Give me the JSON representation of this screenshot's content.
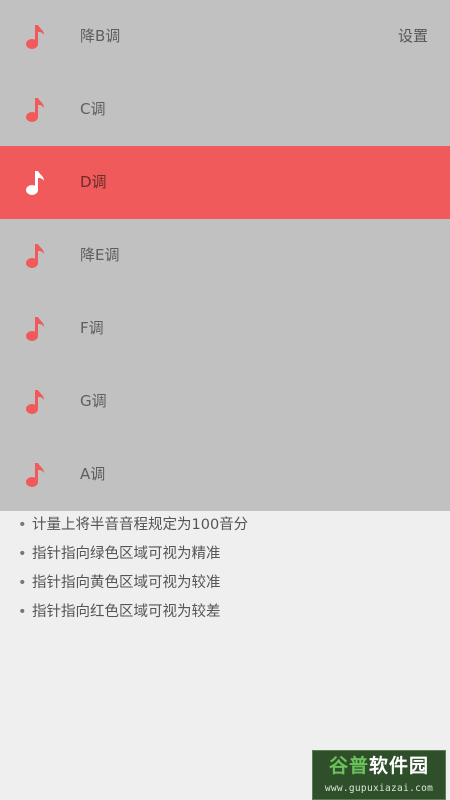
{
  "colors": {
    "list_background": "#c1c1c1",
    "selected_background": "#f05a5a",
    "note_icon": "#f05a5a",
    "note_icon_selected": "#ffffff",
    "page_background": "#efefef"
  },
  "header": {
    "settings_label": "设置"
  },
  "keys": [
    {
      "label": "降B调",
      "icon": "music-note-icon",
      "selected": false
    },
    {
      "label": "C调",
      "icon": "music-note-icon",
      "selected": false
    },
    {
      "label": "D调",
      "icon": "music-note-icon",
      "selected": true
    },
    {
      "label": "降E调",
      "icon": "music-note-icon",
      "selected": false
    },
    {
      "label": "F调",
      "icon": "music-note-icon",
      "selected": false
    },
    {
      "label": "G调",
      "icon": "music-note-icon",
      "selected": false
    },
    {
      "label": "A调",
      "icon": "music-note-icon",
      "selected": false
    }
  ],
  "tips": {
    "bullet": "•",
    "items": [
      "计量上将半音音程规定为100音分",
      "指针指向绿色区域可视为精准",
      "指针指向黄色区域可视为较准",
      "指针指向红色区域可视为较差"
    ]
  },
  "watermark": {
    "title_part1": "谷普",
    "title_part2": "软件园",
    "url": "www.gupuxiazai.com"
  }
}
